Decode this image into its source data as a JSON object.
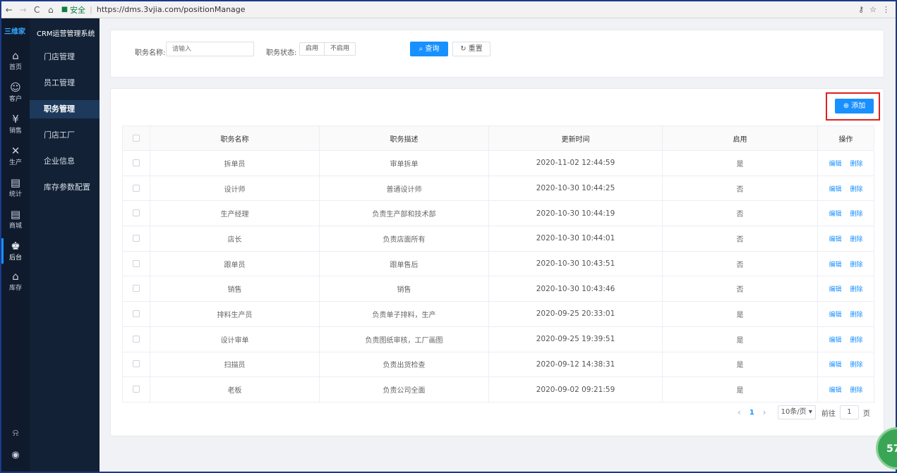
{
  "browser": {
    "secure_label": "安全",
    "url": "https://dms.3vjia.com/positionManage"
  },
  "rail": {
    "logo": "三维家",
    "items": [
      {
        "label": "首页",
        "icon": "home-icon",
        "glyph": "⌂"
      },
      {
        "label": "客户",
        "icon": "users-icon",
        "glyph": "☺"
      },
      {
        "label": "销售",
        "icon": "yen-icon",
        "glyph": "¥"
      },
      {
        "label": "生产",
        "icon": "tools-icon",
        "glyph": "✕"
      },
      {
        "label": "统计",
        "icon": "document-icon",
        "glyph": "▤"
      },
      {
        "label": "商城",
        "icon": "document-icon",
        "glyph": "▤"
      },
      {
        "label": "后台",
        "icon": "admin-icon",
        "glyph": "♚"
      },
      {
        "label": "库存",
        "icon": "warehouse-icon",
        "glyph": "⌂"
      }
    ]
  },
  "submenu": {
    "title": "CRM运营管理系统",
    "items": [
      "门店管理",
      "员工管理",
      "职务管理",
      "门店工厂",
      "企业信息",
      "库存参数配置"
    ]
  },
  "search": {
    "name_label": "职务名称:",
    "name_placeholder": "请输入",
    "status_label": "职务状态:",
    "status_options": [
      "启用",
      "不启用"
    ],
    "query_label": "查询",
    "reset_label": "重置"
  },
  "toolbar": {
    "add_label": "添加"
  },
  "table": {
    "headers": [
      "职务名称",
      "职务描述",
      "更新时间",
      "启用",
      "操作"
    ],
    "edit_label": "编辑",
    "delete_label": "删除",
    "rows": [
      {
        "name": "拆单员",
        "desc": "审单拆单",
        "time": "2020-11-02 12:44:59",
        "enabled": "是"
      },
      {
        "name": "设计师",
        "desc": "普通设计师",
        "time": "2020-10-30 10:44:25",
        "enabled": "否"
      },
      {
        "name": "生产经理",
        "desc": "负责生产部和技术部",
        "time": "2020-10-30 10:44:19",
        "enabled": "否"
      },
      {
        "name": "店长",
        "desc": "负责店面所有",
        "time": "2020-10-30 10:44:01",
        "enabled": "否"
      },
      {
        "name": "跟单员",
        "desc": "跟单售后",
        "time": "2020-10-30 10:43:51",
        "enabled": "否"
      },
      {
        "name": "销售",
        "desc": "销售",
        "time": "2020-10-30 10:43:46",
        "enabled": "否"
      },
      {
        "name": "排料生产员",
        "desc": "负责单子排料，生产",
        "time": "2020-09-25 20:33:01",
        "enabled": "是"
      },
      {
        "name": "设计审单",
        "desc": "负责图纸审核，工厂画图",
        "time": "2020-09-25 19:39:51",
        "enabled": "是"
      },
      {
        "name": "扫描员",
        "desc": "负责出货检查",
        "time": "2020-09-12 14:38:31",
        "enabled": "是"
      },
      {
        "name": "老板",
        "desc": "负责公司全面",
        "time": "2020-09-02 09:21:59",
        "enabled": "是"
      }
    ]
  },
  "pagination": {
    "current": "1",
    "page_size": "10条/页",
    "goto_label": "前往",
    "goto_value": "1",
    "page_unit": "页"
  },
  "badge": {
    "value": "57"
  }
}
